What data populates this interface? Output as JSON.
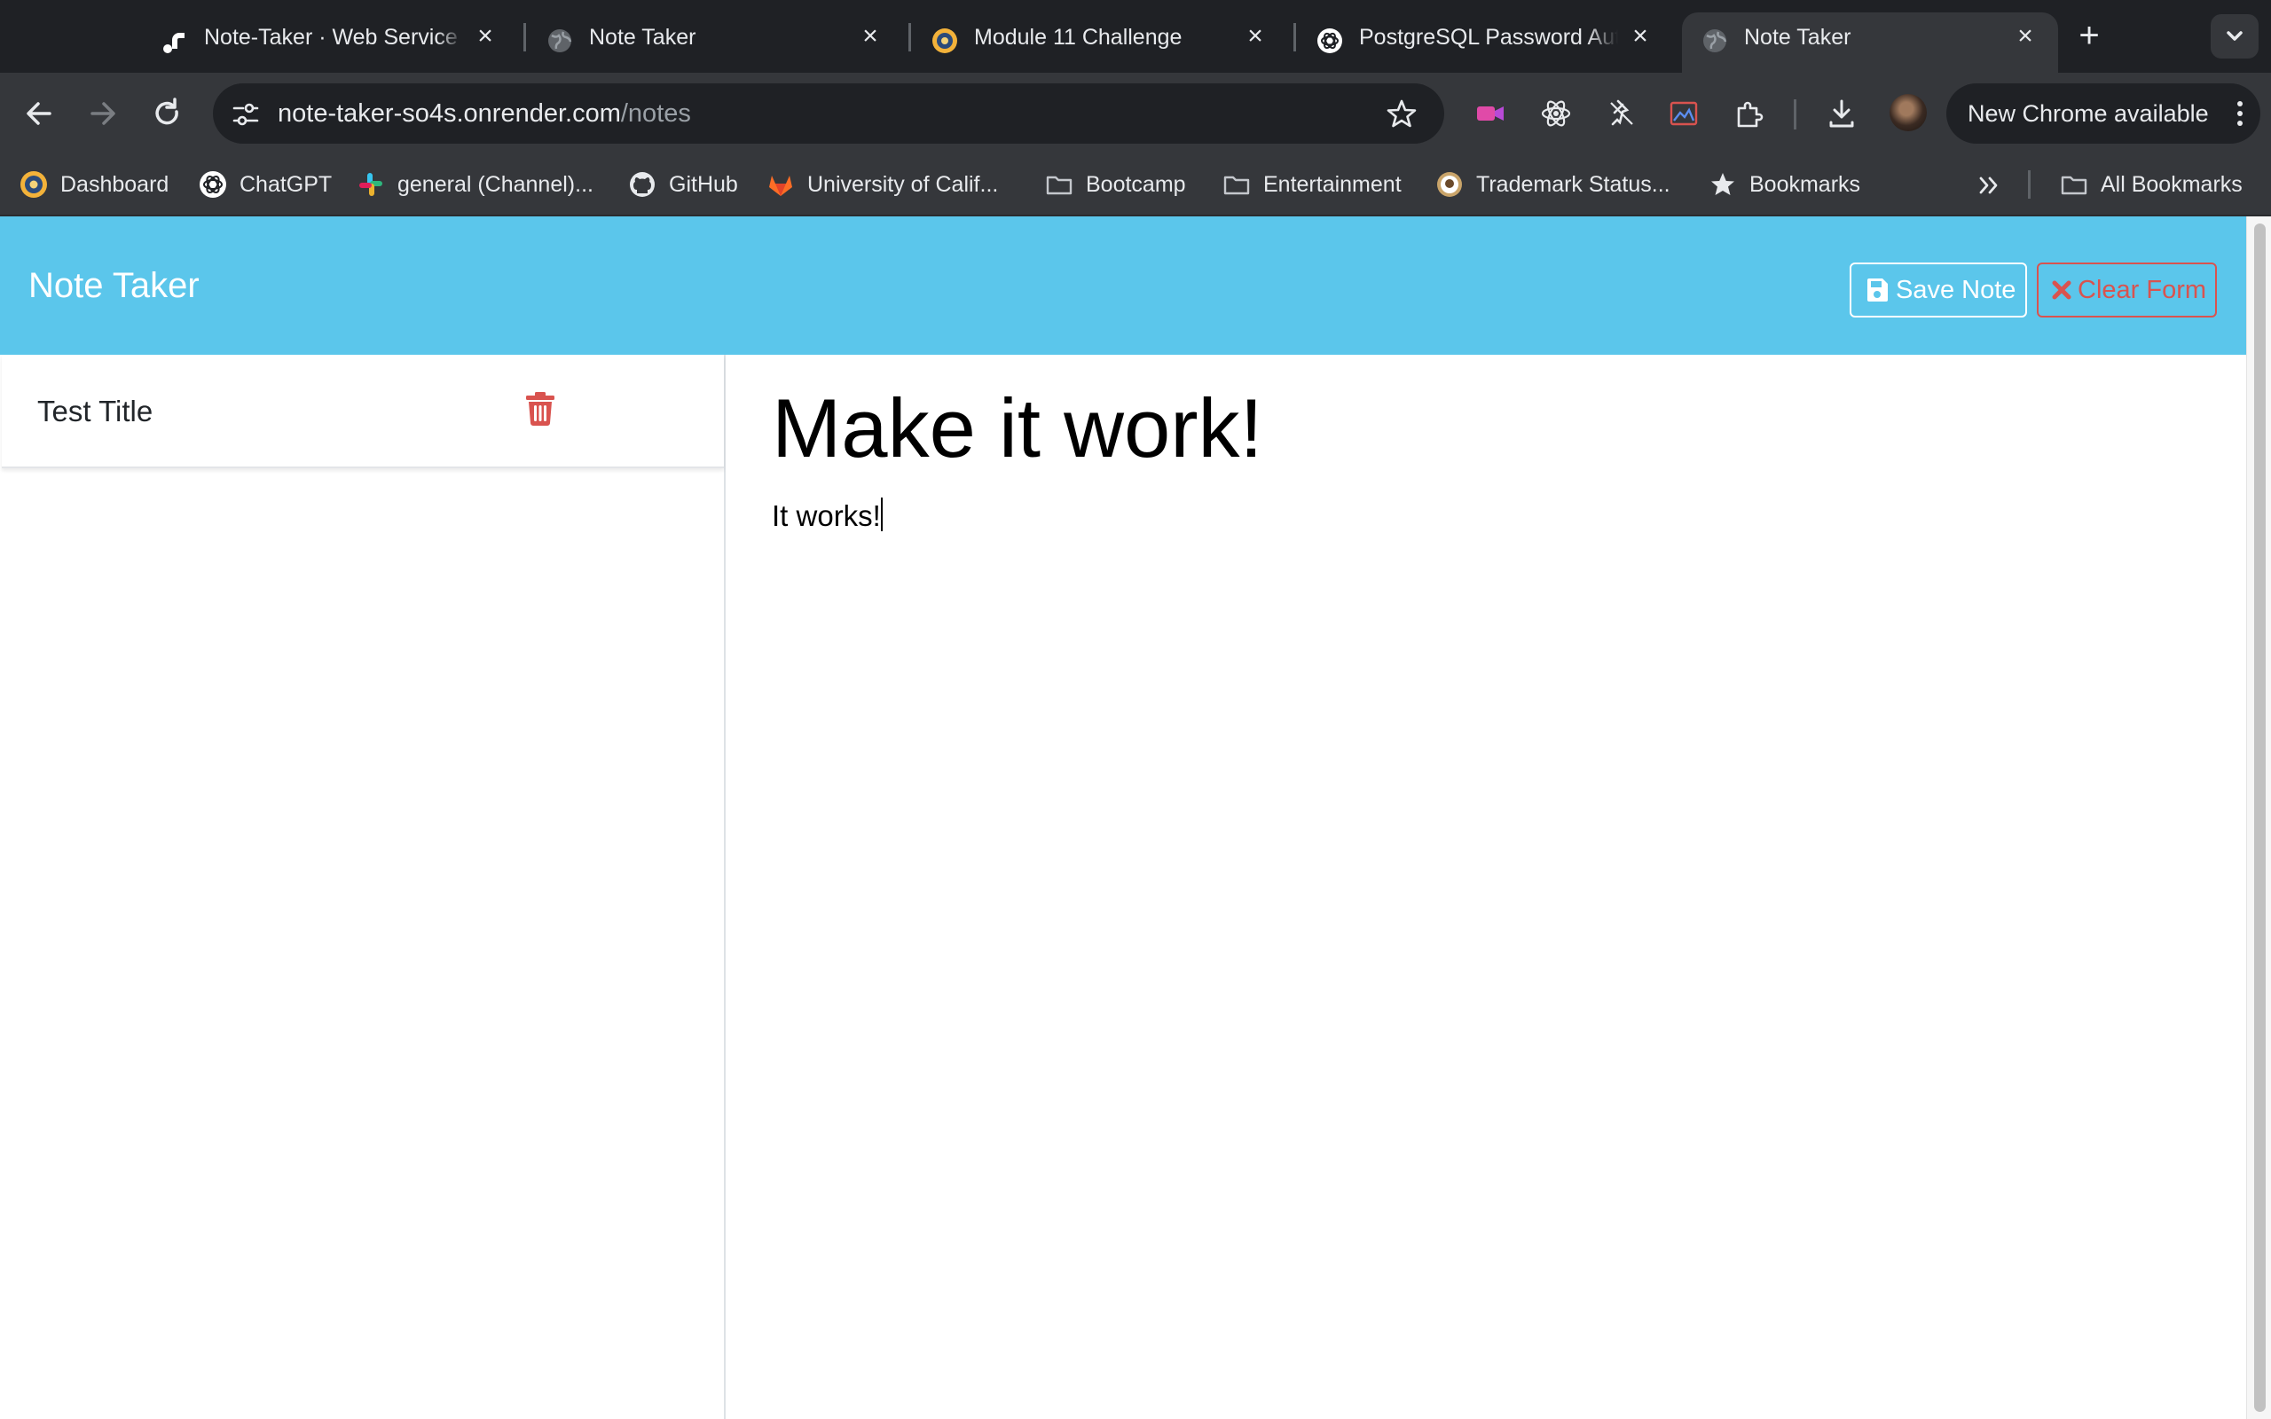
{
  "browser": {
    "tabs": [
      {
        "title": "Note-Taker · Web Service | Render",
        "icon": "render-logo-icon",
        "active": false
      },
      {
        "title": "Note Taker",
        "icon": "globe-icon",
        "active": false
      },
      {
        "title": "Module 11 Challenge",
        "icon": "bootcamp-logo-icon",
        "active": false
      },
      {
        "title": "PostgreSQL Password Authentication",
        "icon": "chatgpt-logo-icon",
        "active": false
      },
      {
        "title": "Note Taker",
        "icon": "globe-icon",
        "active": true
      }
    ],
    "url_host": "note-taker-so4s.onrender.com",
    "url_path": "/notes",
    "update_label": "New Chrome available",
    "bookmarks": [
      {
        "label": "Dashboard",
        "icon": "bootcamp-logo-icon"
      },
      {
        "label": "ChatGPT",
        "icon": "chatgpt-logo-icon"
      },
      {
        "label": "general (Channel)...",
        "icon": "slack-logo-icon"
      },
      {
        "label": "GitHub",
        "icon": "github-logo-icon"
      },
      {
        "label": "University of Calif...",
        "icon": "gitlab-logo-icon"
      },
      {
        "label": "Bootcamp",
        "icon": "folder-icon"
      },
      {
        "label": "Entertainment",
        "icon": "folder-icon"
      },
      {
        "label": "Trademark Status...",
        "icon": "trademark-seal-icon"
      },
      {
        "label": "Bookmarks",
        "icon": "star-icon"
      }
    ],
    "all_bookmarks_label": "All Bookmarks"
  },
  "app": {
    "brand": "Note Taker",
    "save_label": "Save Note",
    "clear_label": "Clear Form",
    "notes": [
      {
        "title": "Test Title"
      }
    ],
    "active_note": {
      "title": "Make it work!",
      "text": "It works!"
    }
  },
  "colors": {
    "navbar": "#5bc6eb",
    "danger": "#d9534f",
    "chrome_dark": "#1f2125",
    "chrome_toolbar": "#35373b"
  }
}
